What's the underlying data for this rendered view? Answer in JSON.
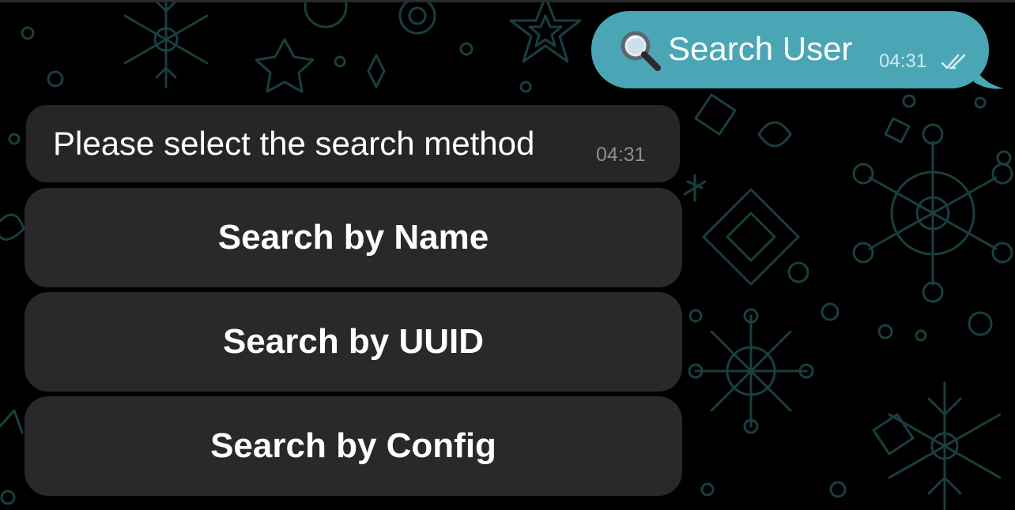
{
  "chat": {
    "outgoing": {
      "icon": "magnifying-glass-emoji",
      "text": "Search User",
      "time": "04:31",
      "status_icon": "double-check-icon",
      "bubble_color": "#4aa6b5"
    },
    "incoming": {
      "text": "Please select the search method",
      "time": "04:31",
      "bubble_color": "#262628"
    },
    "keyboard": {
      "buttons": [
        {
          "label": "Search by Name"
        },
        {
          "label": "Search by UUID"
        },
        {
          "label": "Search by Config"
        }
      ],
      "button_color": "#29292b"
    }
  },
  "wallpaper": {
    "pattern": "snowflake-doodles",
    "background_color": "#000000",
    "pattern_color": "#1f4a4d"
  }
}
